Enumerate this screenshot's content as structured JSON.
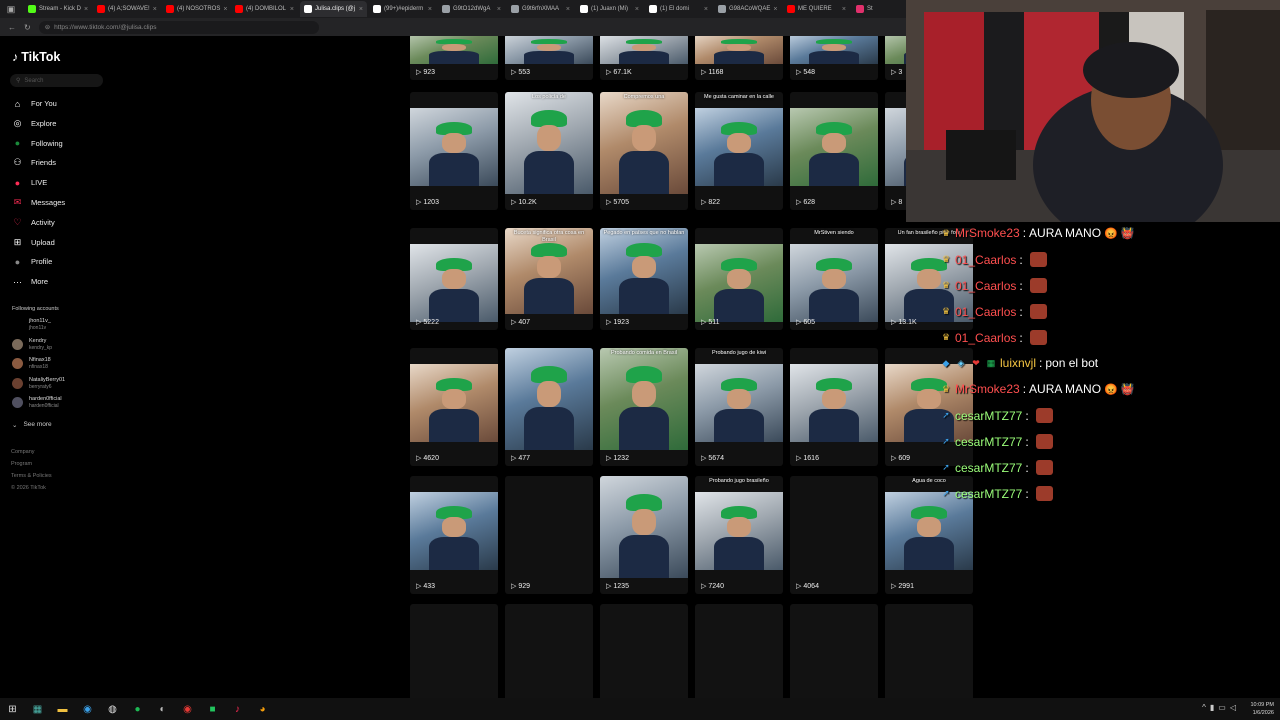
{
  "browser": {
    "tabs": [
      {
        "title": "Stream - Kick D",
        "color": "#53fc18",
        "active": false
      },
      {
        "title": "(4) A;SOWAVE!",
        "color": "#ff0000",
        "active": false
      },
      {
        "title": "(4) NOSOTROS",
        "color": "#ff0000",
        "active": false
      },
      {
        "title": "(4) DOMBILOL",
        "color": "#ff0000",
        "active": false
      },
      {
        "title": "Julisa.clips (@j",
        "color": "#ffffff",
        "active": true
      },
      {
        "title": "(99+)#epiderm",
        "color": "#ffffff",
        "active": false
      },
      {
        "title": "G9tO12dWgA",
        "color": "#9aa0a6",
        "active": false
      },
      {
        "title": "G9t6rfnXMAA",
        "color": "#9aa0a6",
        "active": false
      },
      {
        "title": "(1) Juaxn (Mi)",
        "color": "#ffffff",
        "active": false
      },
      {
        "title": "(1) El domi",
        "color": "#ffffff",
        "active": false
      },
      {
        "title": "G98ACoWQAE",
        "color": "#9aa0a6",
        "active": false
      },
      {
        "title": "ME QUIERE",
        "color": "#ff0000",
        "active": false
      },
      {
        "title": "St",
        "color": "#e1306c",
        "active": false
      }
    ],
    "url": "https://www.tiktok.com/@julisa.clips"
  },
  "sidebar": {
    "logo": "TikTok",
    "search_placeholder": "Search",
    "nav": [
      {
        "label": "For You",
        "icon": "home-icon",
        "glyph": "⌂"
      },
      {
        "label": "Explore",
        "icon": "compass-icon",
        "glyph": "◎"
      },
      {
        "label": "Following",
        "icon": "following-icon",
        "glyph": "●"
      },
      {
        "label": "Friends",
        "icon": "friends-icon",
        "glyph": "⚇"
      },
      {
        "label": "LIVE",
        "icon": "live-icon",
        "glyph": "●"
      },
      {
        "label": "Messages",
        "icon": "messages-icon",
        "glyph": "✉"
      },
      {
        "label": "Activity",
        "icon": "activity-icon",
        "glyph": "♡"
      },
      {
        "label": "Upload",
        "icon": "upload-icon",
        "glyph": "⊞"
      },
      {
        "label": "Profile",
        "icon": "profile-icon",
        "glyph": "●"
      },
      {
        "label": "More",
        "icon": "more-icon",
        "glyph": "···"
      }
    ],
    "following_header": "Following accounts",
    "accounts": [
      {
        "name": "jhon11v_",
        "handle": "jhon11v"
      },
      {
        "name": "Kendry",
        "handle": "kendry_kp"
      },
      {
        "name": "Nfinax18",
        "handle": "nfinax18"
      },
      {
        "name": "NataliyBerry01",
        "handle": "berryraty6"
      },
      {
        "name": "harden0fficial",
        "handle": "harden0fficial"
      }
    ],
    "see_more": "See more",
    "footer": [
      "Company",
      "Program",
      "Terms & Policies",
      "© 2026 TikTok"
    ]
  },
  "grid": {
    "rows": [
      [
        {
          "views": "923",
          "caption": "",
          "type": "img"
        },
        {
          "views": "553",
          "caption": "",
          "type": "img"
        },
        {
          "views": "67.1K",
          "caption": "",
          "type": "img"
        },
        {
          "views": "1168",
          "caption": "",
          "type": "img"
        },
        {
          "views": "548",
          "caption": "",
          "type": "img"
        },
        {
          "views": "3",
          "caption": "",
          "type": "img"
        }
      ],
      [
        {
          "views": "1203",
          "caption": "",
          "type": "img"
        },
        {
          "views": "10.2K",
          "caption": "Los policía de",
          "type": "tall"
        },
        {
          "views": "5705",
          "caption": "Compremos una",
          "type": "tall"
        },
        {
          "views": "822",
          "caption": "Me gusta caminar en la calle",
          "type": "img"
        },
        {
          "views": "628",
          "caption": "",
          "type": "img"
        },
        {
          "views": "8",
          "caption": "",
          "type": "img"
        }
      ],
      [
        {
          "views": "5222",
          "caption": "",
          "type": "img"
        },
        {
          "views": "407",
          "caption": "Buceta significa otra cosa en Brasil",
          "type": "tall"
        },
        {
          "views": "1923",
          "caption": "Pegado en países que no hablan",
          "type": "tall"
        },
        {
          "views": "511",
          "caption": "",
          "type": "img"
        },
        {
          "views": "605",
          "caption": "MrStiven siendo",
          "type": "img"
        },
        {
          "views": "13.1K",
          "caption": "Un fan brasileño pide foto",
          "type": "img"
        }
      ],
      [
        {
          "views": "4620",
          "caption": "",
          "type": "img"
        },
        {
          "views": "477",
          "caption": "",
          "type": "tall"
        },
        {
          "views": "1232",
          "caption": "Probando comida en Brasil",
          "type": "tall"
        },
        {
          "views": "5674",
          "caption": "Probando jugo de kiwi",
          "type": "img"
        },
        {
          "views": "1616",
          "caption": "",
          "type": "img"
        },
        {
          "views": "609",
          "caption": "",
          "type": "img"
        }
      ],
      [
        {
          "views": "433",
          "caption": "",
          "type": "img"
        },
        {
          "views": "929",
          "caption": "",
          "type": "empty"
        },
        {
          "views": "1235",
          "caption": "",
          "type": "tall"
        },
        {
          "views": "7240",
          "caption": "Probando jugo brasileño",
          "type": "img"
        },
        {
          "views": "4064",
          "caption": "",
          "type": "empty"
        },
        {
          "views": "2991",
          "caption": "Agua de coco",
          "type": "img"
        }
      ]
    ]
  },
  "chat": [
    {
      "user": "MrSmoke23",
      "color": "#ff4f4f",
      "text": "AURA MANO",
      "emote": false,
      "badge": "crown"
    },
    {
      "user": "01_Caarlos",
      "color": "#ff4f4f",
      "text": "",
      "emote": true,
      "badge": "crown"
    },
    {
      "user": "01_Caarlos",
      "color": "#ff4f4f",
      "text": "",
      "emote": true,
      "badge": "crown"
    },
    {
      "user": "01_Caarlos",
      "color": "#ff4f4f",
      "text": "",
      "emote": true,
      "badge": "crown"
    },
    {
      "user": "01_Caarlos",
      "color": "#ff4f4f",
      "text": "",
      "emote": true,
      "badge": "crown"
    },
    {
      "user": "luixnvjl",
      "color": "#f5c542",
      "text": "pon el bot",
      "emote": false,
      "badge": "multi"
    },
    {
      "user": "MrSmoke23",
      "color": "#ff4f4f",
      "text": "AURA MANO",
      "emote": false,
      "badge": "crown"
    },
    {
      "user": "cesarMTZ77",
      "color": "#9bff7a",
      "text": "",
      "emote": true,
      "badge": "arrow"
    },
    {
      "user": "cesarMTZ77",
      "color": "#9bff7a",
      "text": "",
      "emote": true,
      "badge": "arrow"
    },
    {
      "user": "cesarMTZ77",
      "color": "#9bff7a",
      "text": "",
      "emote": true,
      "badge": "arrow"
    },
    {
      "user": "cesarMTZ77",
      "color": "#9bff7a",
      "text": "",
      "emote": true,
      "badge": "arrow"
    }
  ],
  "taskbar": {
    "time": "10:09 PM",
    "date": "1/6/2026"
  }
}
